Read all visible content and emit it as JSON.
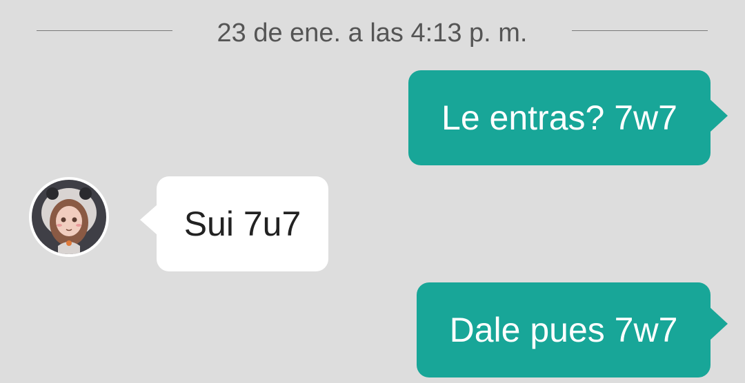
{
  "chat": {
    "date_separator": "23 de ene. a las 4:13 p. m.",
    "messages": [
      {
        "direction": "outgoing",
        "text": "Le entras? 7w7"
      },
      {
        "direction": "incoming",
        "text": "Sui 7u7"
      },
      {
        "direction": "outgoing",
        "text": "Dale pues 7w7"
      }
    ]
  },
  "colors": {
    "background": "#dddddd",
    "outgoing_bubble": "#18a698",
    "incoming_bubble": "#ffffff"
  },
  "icons": {
    "sender_avatar": "avatar-icon"
  }
}
